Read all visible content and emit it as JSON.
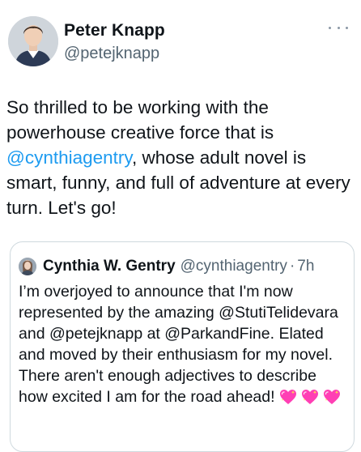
{
  "tweet": {
    "display_name": "Peter Knapp",
    "handle": "@petejknapp",
    "text_part1": "So thrilled to be working with the powerhouse creative force that is ",
    "mention": "@cynthiagentry",
    "text_part2": ", whose adult novel is smart, funny, and full of adventure at every turn. Let's go!"
  },
  "quote": {
    "display_name": "Cynthia W. Gentry",
    "handle": "@cynthiagentry",
    "separator": "·",
    "time": "7h",
    "text": "I’m overjoyed to announce that I'm now represented by the amazing @StutiTelidevara and @petejknapp at @ParkandFine. Elated and moved by their enthusiasm for my novel. There aren't enough adjectives to describe how excited I am for the road ahead!",
    "emoji_count": 3
  },
  "icons": {
    "more": "more-horizontal-icon",
    "heart": "sparkling-heart-icon"
  },
  "colors": {
    "link": "#1d9bf0",
    "secondary": "#536471",
    "text": "#0f1419",
    "border": "#cfd9de",
    "heart": "#ff3fb4"
  }
}
